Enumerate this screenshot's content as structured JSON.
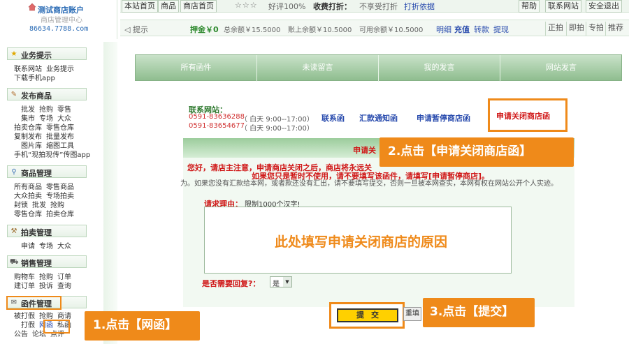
{
  "header": {
    "account_title": "测试商店账户",
    "admin_center": "商店管理中心",
    "shop_url": "86634.7788.com",
    "top_tabs": [
      "本站首页",
      "商品",
      "商店首页"
    ],
    "stars": "☆☆☆",
    "praise": "好评100%",
    "fee_label": "收费打折：",
    "fee_value": "不享受打折",
    "fee_link": "打折依据",
    "right_links": [
      "帮助",
      "联系网站",
      "安全退出"
    ],
    "tip": "提示",
    "deposit": "押金￥0",
    "total_balance": "总余额￥15.5000",
    "account_balance": "账上余额￥10.5000",
    "available_balance": "可用余额￥10.5000",
    "account_links": [
      "明细",
      "充值",
      "转款",
      "提现"
    ],
    "quick_links": [
      "正拍",
      "即拍",
      "专拍",
      "推荐"
    ]
  },
  "sidebar": {
    "sections": [
      {
        "title": "业务提示",
        "icon": "star-icon",
        "items": [
          "联系网站",
          "业务提示",
          "下载手机app"
        ]
      },
      {
        "title": "发布商品",
        "icon": "edit-icon",
        "items": [
          "批发",
          "抢购",
          "零售",
          "集市",
          "专场",
          "大众",
          "拍卖仓库",
          "零售仓库",
          "复制发布",
          "批量发布",
          "图片库",
          "缩图工具",
          "手机“现拍现传”传图app"
        ]
      },
      {
        "title": "商品管理",
        "icon": "search-icon",
        "items": [
          "所有商品",
          "零售商品",
          "大众拍卖",
          "专场拍卖",
          "封锁",
          "批发",
          "抢购",
          "零售仓库",
          "拍卖仓库"
        ]
      },
      {
        "title": "拍卖管理",
        "icon": "gavel-icon",
        "items": [
          "申请",
          "专场",
          "大众"
        ]
      },
      {
        "title": "销售管理",
        "icon": "cart-icon",
        "items": [
          "购物车",
          "抢购",
          "订单",
          "建订单",
          "投诉",
          "查询"
        ]
      },
      {
        "title": "函件管理",
        "icon": "mail-icon",
        "items": [
          "被打假",
          "抢购",
          "商请",
          "打假",
          "网函",
          "私函",
          "公告",
          "论坛",
          "点评"
        ]
      }
    ]
  },
  "main": {
    "tabs": [
      "所有函件",
      "未读留言",
      "我的发言",
      "网站发言"
    ],
    "contact_label": "联系网站：",
    "phones": [
      "0591-83636288",
      "0591-83654677"
    ],
    "hours": [
      "（ 白天 9:00--17:00）",
      "（ 白天 9:00--17:00）"
    ],
    "contact_links": [
      "联系函",
      "汇款通知函",
      "申请暂停商店函"
    ],
    "close_shop_link": "申请关闭商店函",
    "form_title": "申请关",
    "notice_line1": "您好，请店主注意，申请商店关闭之后，商店将永远关",
    "notice_line2": "如果您只是暂时不使用，请不要填写该函件，请填写[申请暂停商店]。",
    "notice_line3": "为。如果您没有汇款给本网，或者款还没有汇出，请不要填写提交，否则一旦被本网查实，本网有权在网站公开个人实迹。",
    "reason_label": "请求理由：",
    "reason_hint": "限制1000个汉字!",
    "reason_text": "此处填写申请关闭商店的原因",
    "reply_label": "是否需要回复?：",
    "reply_value": "是",
    "submit_label": "提交",
    "reset_label": "重填"
  },
  "callouts": {
    "step1": "1.点击【网函】",
    "step2": "2.点击【申请关闭商店函】",
    "step3": "3.点击【提交】"
  },
  "colors": {
    "accent_orange": "#ef8a1a",
    "red_text": "#d01818",
    "green_header": "#8fbd8f",
    "submit_yellow": "#ffd000"
  }
}
